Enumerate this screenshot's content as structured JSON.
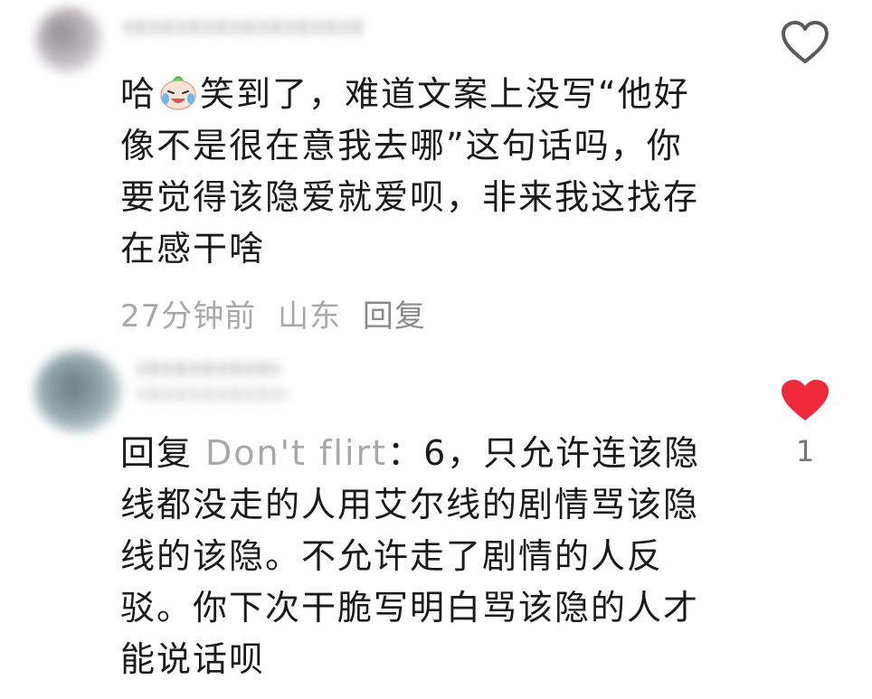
{
  "comments": [
    {
      "text_before_emoji": "哈",
      "emoji_name": "laughing-crying-face",
      "text_after_emoji": "笑到了，难道文案上没写“他好像不是很在意我去哪”这句话吗，你要觉得该隐爱就爱呗，非来我这找存在感干啥",
      "time": "27分钟前",
      "location": "山东",
      "reply_label": "回复",
      "liked": false,
      "like_count": ""
    },
    {
      "reply_prefix": "回复",
      "reply_to_user": "Don't flirt",
      "text": "：6，只允许连该隐线都没走的人用艾尔线的剧情骂该隐线的该隐。不允许走了剧情的人反驳。你下次干脆写明白骂该隐的人才能说话呗",
      "liked": true,
      "like_count": "1",
      "like_color": "#f0283c"
    }
  ]
}
